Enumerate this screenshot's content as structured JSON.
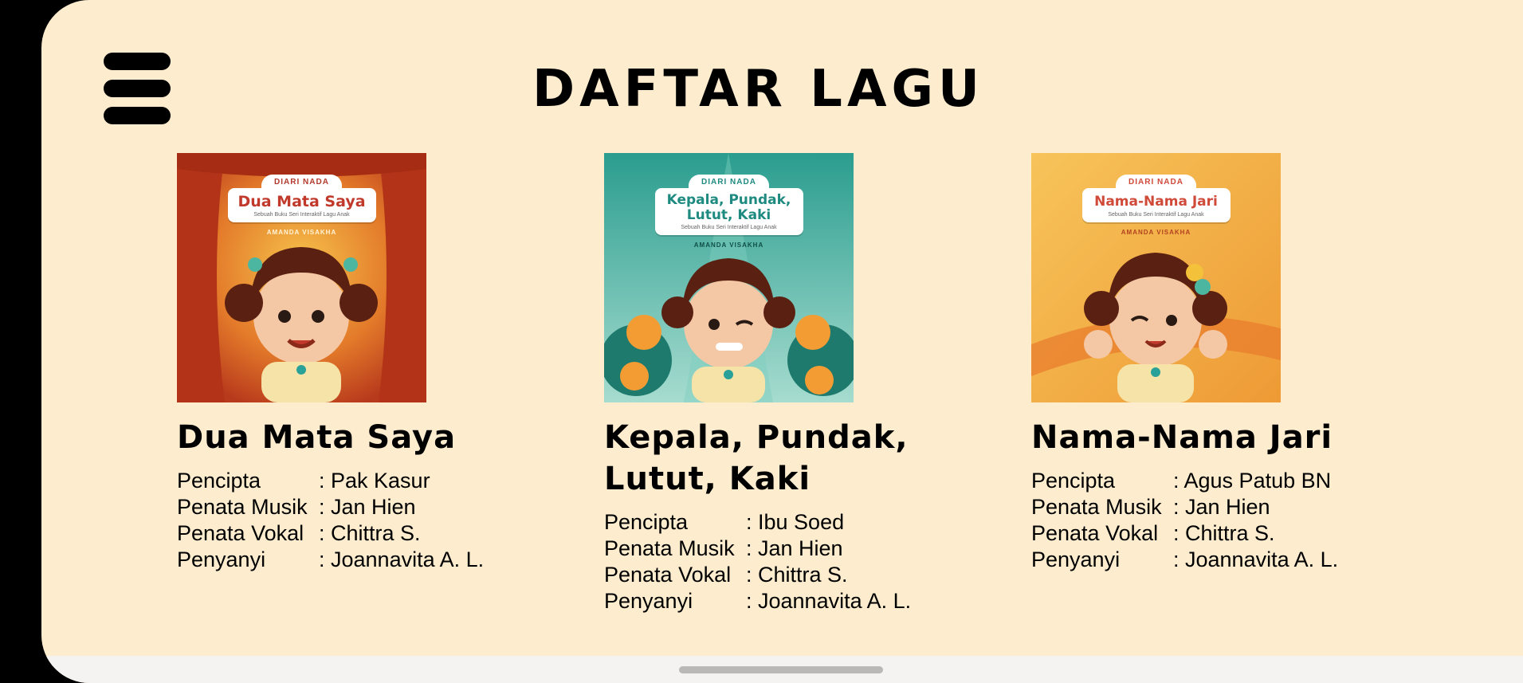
{
  "header": {
    "title": "DAFTAR LAGU",
    "menu_icon": "hamburger-menu-icon"
  },
  "songs": [
    {
      "title": "Dua Mata Saya",
      "cover": {
        "series": "DIARI NADA",
        "title": "Dua Mata Saya",
        "subtitle": "Sebuah Buku Seri Interaktif Lagu Anak",
        "author": "AMANDA VISAKHA",
        "title_color": "#c0392b",
        "bg_colors": [
          "#c6471f",
          "#f29a2e"
        ]
      },
      "credits": [
        {
          "label": "Pencipta",
          "value": ": Pak Kasur"
        },
        {
          "label": "Penata Musik",
          "value": ": Jan Hien"
        },
        {
          "label": "Penata Vokal",
          "value": ": Chittra S."
        },
        {
          "label": "Penyanyi",
          "value": ": Joannavita A. L."
        }
      ]
    },
    {
      "title": "Kepala, Pundak, Lutut, Kaki",
      "cover": {
        "series": "DIARI NADA",
        "title": "Kepala, Pundak, Lutut, Kaki",
        "subtitle": "Sebuah Buku Seri Interaktif Lagu Anak",
        "author": "AMANDA VISAKHA",
        "title_color": "#1f8a80",
        "bg_colors": [
          "#2a9d8f",
          "#9fd9cc"
        ]
      },
      "credits": [
        {
          "label": "Pencipta",
          "value": ": Ibu Soed"
        },
        {
          "label": "Penata Musik",
          "value": ": Jan Hien"
        },
        {
          "label": "Penata Vokal",
          "value": ": Chittra S."
        },
        {
          "label": "Penyanyi",
          "value": ": Joannavita A. L."
        }
      ]
    },
    {
      "title": "Nama-Nama Jari",
      "cover": {
        "series": "DIARI NADA",
        "title": "Nama-Nama Jari",
        "subtitle": "Sebuah Buku Seri Interaktif Lagu Anak",
        "author": "AMANDA VISAKHA",
        "title_color": "#d04a3a",
        "bg_colors": [
          "#f0a640",
          "#f7d07a"
        ]
      },
      "credits": [
        {
          "label": "Pencipta",
          "value": ": Agus Patub BN"
        },
        {
          "label": "Penata Musik",
          "value": ": Jan Hien"
        },
        {
          "label": "Penata Vokal",
          "value": ": Chittra S."
        },
        {
          "label": "Penyanyi",
          "value": ": Joannavita A. L."
        }
      ]
    }
  ],
  "colors": {
    "background": "#fdecce",
    "text": "#000000"
  }
}
